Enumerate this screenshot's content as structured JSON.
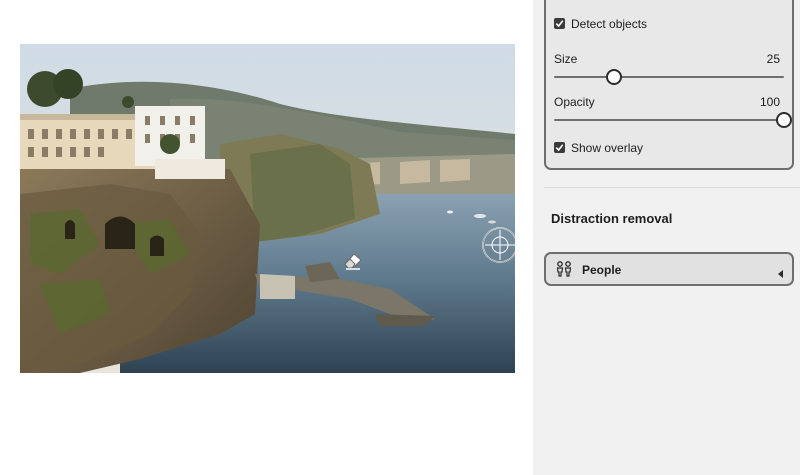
{
  "panel": {
    "detect_objects": {
      "label": "Detect objects",
      "checked": true
    },
    "size": {
      "label": "Size",
      "value": "25"
    },
    "opacity": {
      "label": "Opacity",
      "value": "100"
    },
    "show_overlay": {
      "label": "Show overlay",
      "checked": true
    },
    "section_title": "Distraction removal",
    "people_button": {
      "label": "People"
    }
  },
  "icons": {
    "eraser": "eraser-icon",
    "brush_cursor": "brush-cursor-icon",
    "people": "people-icon",
    "chevron": "chevron-left-icon",
    "checkmark": "checkmark-icon"
  },
  "colors": {
    "panel_bg": "#f1f1f1",
    "card_border": "#6e6e6e",
    "checkbox_fill": "#3a3a3a"
  }
}
